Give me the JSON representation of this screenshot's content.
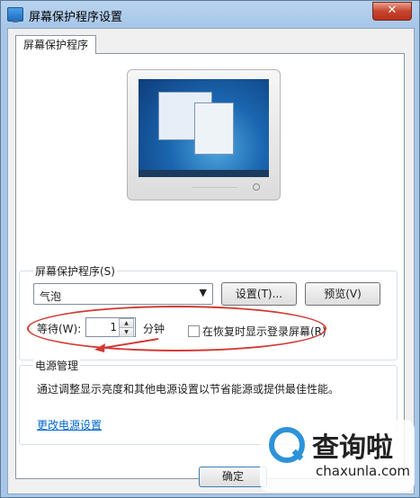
{
  "window": {
    "title": "屏幕保护程序设置",
    "close_glyph": "✕"
  },
  "tab": {
    "label": "屏幕保护程序"
  },
  "screensaver": {
    "group_label": "屏幕保护程序(S)",
    "selected": "气泡",
    "settings_button": "设置(T)...",
    "preview_button": "预览(V)",
    "wait_label": "等待(W):",
    "wait_value": "1",
    "wait_unit": "分钟",
    "resume_checkbox_label": "在恢复时显示登录屏幕(R)",
    "resume_checked": false
  },
  "power": {
    "group_label": "电源管理",
    "description": "通过调整显示亮度和其他电源设置以节省能源或提供最佳性能。",
    "link": "更改电源设置"
  },
  "footer": {
    "ok_button": "确定"
  },
  "watermark": {
    "title": "查询啦",
    "subtitle": "chaxunla.com"
  },
  "colors": {
    "annotation": "#d23a35",
    "link": "#0066cc",
    "accent": "#2d93d9"
  }
}
